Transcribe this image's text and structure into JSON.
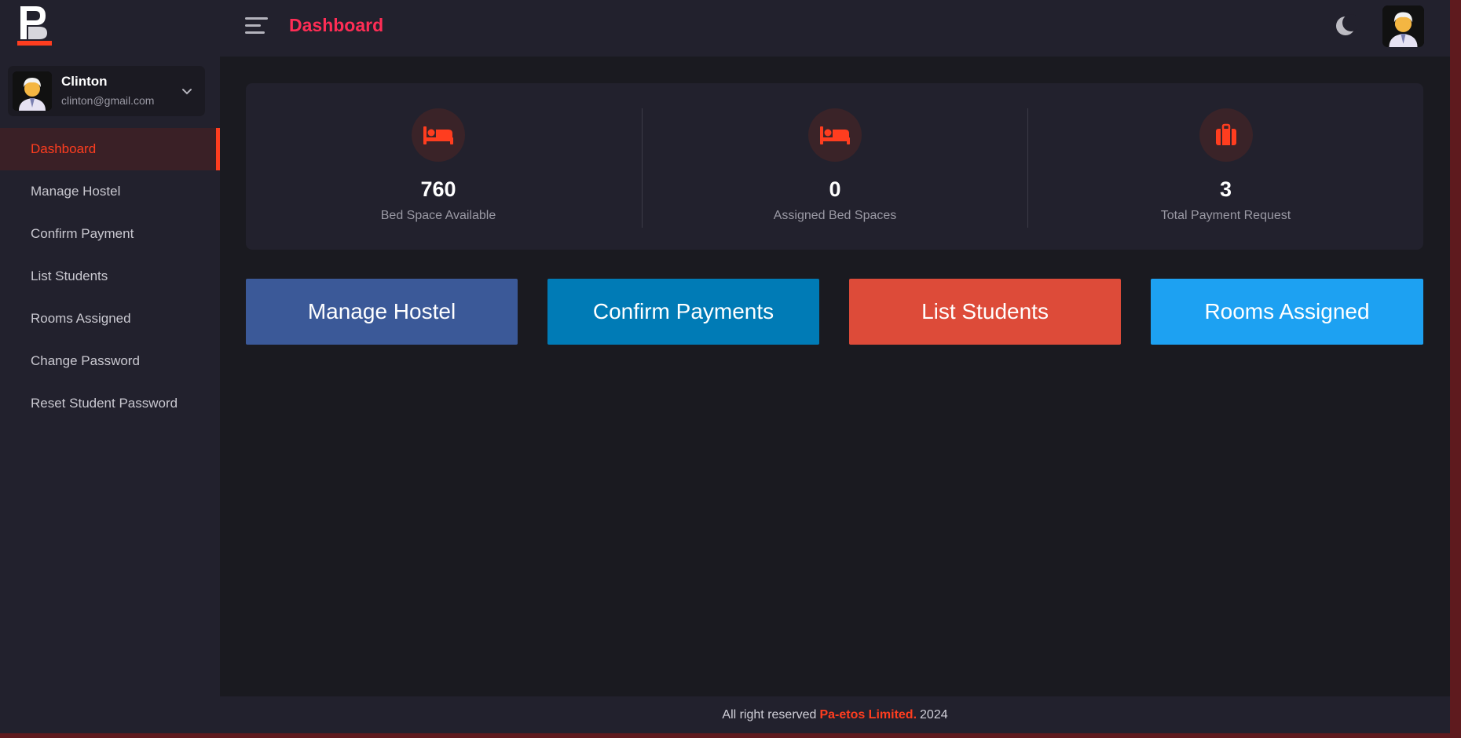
{
  "sidebar": {
    "logo_text": "Pa-etos Limited",
    "profile": {
      "name": "Clinton",
      "email": "clinton@gmail.com"
    },
    "items": [
      {
        "label": "Dashboard",
        "active": true
      },
      {
        "label": "Manage Hostel"
      },
      {
        "label": "Confirm Payment"
      },
      {
        "label": "List Students"
      },
      {
        "label": "Rooms Assigned"
      },
      {
        "label": "Change Password"
      },
      {
        "label": "Reset Student Password"
      }
    ]
  },
  "header": {
    "title": "Dashboard",
    "theme_icon": "moon-icon"
  },
  "stats": [
    {
      "value": "760",
      "label": "Bed Space Available",
      "icon": "bed-icon"
    },
    {
      "value": "0",
      "label": "Assigned Bed Spaces",
      "icon": "bed-icon"
    },
    {
      "value": "3",
      "label": "Total Payment Request",
      "icon": "suitcase-icon"
    }
  ],
  "actions": [
    {
      "label": "Manage Hostel",
      "color": "#3b5998"
    },
    {
      "label": "Confirm Payments",
      "color": "#007bb6"
    },
    {
      "label": "List Students",
      "color": "#dd4b39"
    },
    {
      "label": "Rooms Assigned",
      "color": "#1da1f2"
    }
  ],
  "footer": {
    "prefix": "All right reserved",
    "brand": "Pa-etos Limited.",
    "year": "2024"
  },
  "colors": {
    "accent": "#ff3d1f",
    "title": "#ff2d55",
    "background": "#1a1a20",
    "panel": "#22212d"
  }
}
